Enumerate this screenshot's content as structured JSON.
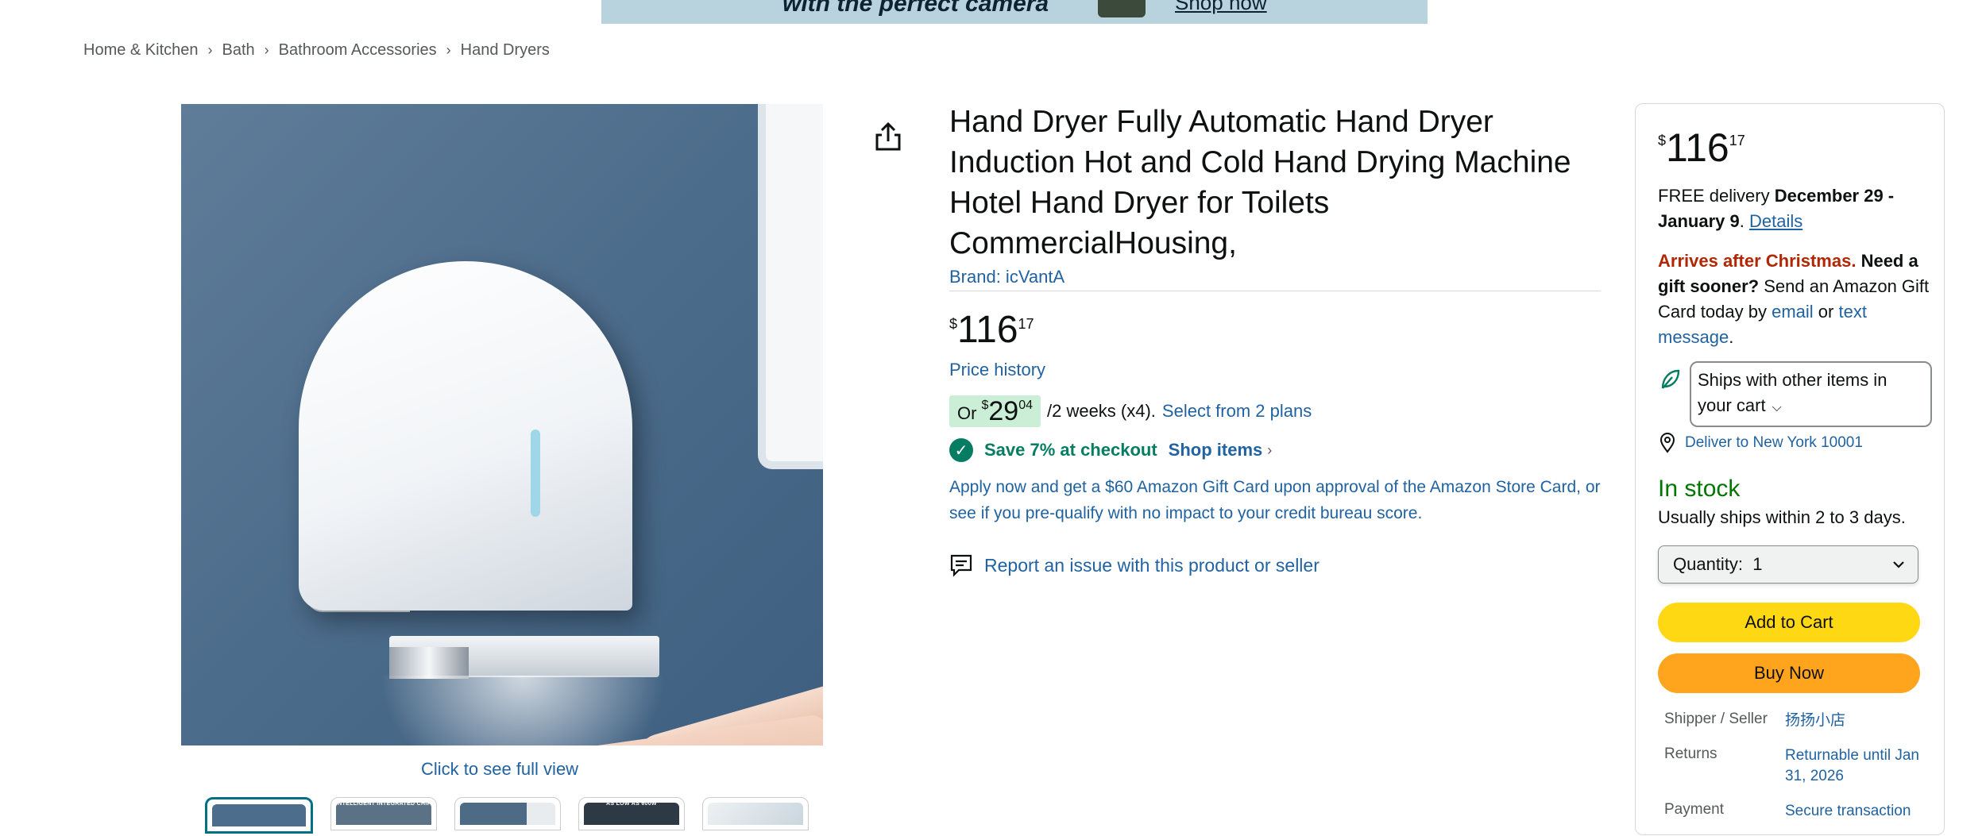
{
  "banner": {
    "text": "with the perfect camera",
    "link": "Shop now"
  },
  "breadcrumb": [
    {
      "label": "Home & Kitchen"
    },
    {
      "label": "Bath"
    },
    {
      "label": "Bathroom Accessories"
    },
    {
      "label": "Hand Dryers"
    }
  ],
  "breadcrumb_sep": "›",
  "gallery": {
    "see_full": "Click to see full view",
    "thumb2_caption": "INTELLIGENT INTEGRATED CHIP CONTROLLED INFRARED LIGHT",
    "thumb4_caption": "AS LOW AS 600W"
  },
  "product": {
    "title": "Hand Dryer Fully Automatic Hand Dryer Induction Hot and Cold Hand Drying Machine Hotel Hand Dryer for Toilets CommercialHousing,",
    "brand": "Brand: icVantA",
    "price": {
      "symbol": "$",
      "whole": "116",
      "fraction": "17"
    },
    "price_history": "Price history",
    "plan": {
      "or": "Or",
      "symbol": "$",
      "whole": "29",
      "fraction": "04",
      "rest": "/2 weeks (x4).",
      "link": "Select from 2 plans"
    },
    "save": {
      "check": "✓",
      "text": "Save 7% at checkout",
      "link": "Shop items",
      "chevron": "›"
    },
    "apply_text": "Apply now and get a $60 Amazon Gift Card upon approval of the Amazon Store Card, or see if you pre-qualify with no impact to your credit bureau score.",
    "report": "Report an issue with this product or seller"
  },
  "buybox": {
    "price": {
      "symbol": "$",
      "whole": "116",
      "fraction": "17"
    },
    "delivery_prefix": "FREE delivery",
    "delivery_dates": "December 29 - January 9",
    "delivery_period": ".",
    "details": "Details",
    "arrives": "Arrives after Christmas.",
    "need_gift": "Need a gift sooner?",
    "gift_text": "Send an Amazon Gift Card today by",
    "email": "email",
    "or": "or",
    "text_message": "text message",
    "end_period": ".",
    "ships_with": "Ships with other items in your cart",
    "deliver_to": "Deliver to New York 10001",
    "stock": "In stock",
    "usually": "Usually ships within 2 to 3 days.",
    "quantity_label": "Quantity:",
    "quantity_value": "1",
    "add_to_cart": "Add to Cart",
    "buy_now": "Buy Now",
    "info": [
      {
        "key": "Shipper / Seller",
        "value": "扬扬小店"
      },
      {
        "key": "Returns",
        "value": "Returnable until Jan 31, 2026"
      },
      {
        "key": "Payment",
        "value": "Secure transaction"
      }
    ]
  },
  "colors": {
    "link": "#2162A1",
    "add_to_cart": "#FFD814",
    "buy_now": "#FFA41C",
    "in_stock": "#007600",
    "arrives": "#B12704",
    "save_green": "#067D62"
  }
}
